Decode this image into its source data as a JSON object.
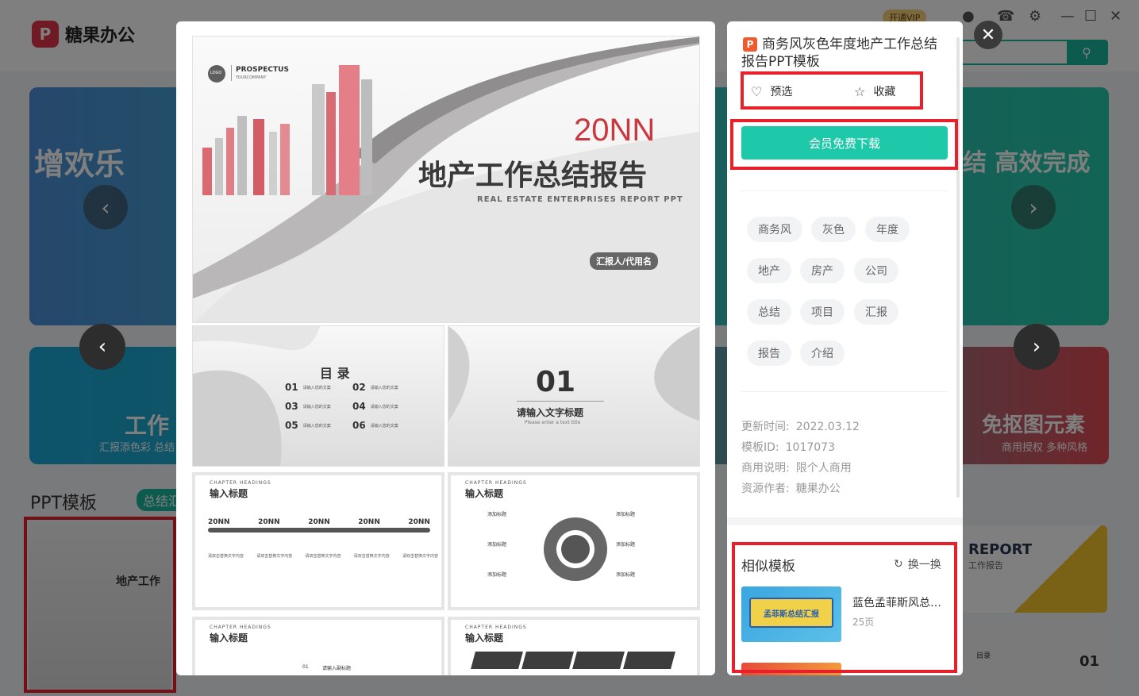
{
  "app": {
    "logo_text": "糖果办公",
    "vip_label": "开通VIP",
    "banner1_left": "增欢乐",
    "banner1_right": "结  高效完成",
    "banner2_left": "工作",
    "banner2_left_sub": "汇报添色彩 总结",
    "banner2_right": "免抠图元素",
    "banner2_right_sub": "商用授权 多种风格",
    "section_title": "PPT模板",
    "section_chip": "总结汇",
    "bg_thumb_title": "地产工作",
    "bg_thumb2_report": "REPORT",
    "bg_thumb2_sub": "工作报告",
    "bg_thumb3_num": "01",
    "bg_thumb3_title": "目录"
  },
  "preview": {
    "cover": {
      "logo": "LOGO",
      "prospectus": "PROSPECTUS",
      "company": "YOURCOMPANY",
      "year": "20NN",
      "title": "地产工作总结报告",
      "subtitle": "REAL ESTATE ENTERPRISES REPORT PPT",
      "reporter": "汇报人/代用名"
    },
    "toc": {
      "heading": "目  录",
      "items": [
        {
          "num": "01",
          "text": "请输入您的文案"
        },
        {
          "num": "02",
          "text": "请输入您的文案"
        },
        {
          "num": "03",
          "text": "请输入您的文案"
        },
        {
          "num": "04",
          "text": "请输入您的文案"
        },
        {
          "num": "05",
          "text": "请输入您的文案"
        },
        {
          "num": "06",
          "text": "请输入您的文案"
        }
      ]
    },
    "chapter": {
      "num": "01",
      "title": "请输入文字标题",
      "sub": "Please enter a text title"
    },
    "slide_heading": "CHAPTER HEADINGS",
    "slide_title": "输入标题",
    "timeline_years": [
      "20NN",
      "20NN",
      "20NN",
      "20NN",
      "20NN"
    ],
    "timeline_caption": "请双击替换文字内容",
    "radial_label": "添加标题",
    "sub_title_label": "请输入副标题",
    "sub_num": "01"
  },
  "info": {
    "title": "商务风灰色年度地产工作总结报告PPT模板",
    "ppt_icon": "P",
    "preselect": "预选",
    "favorite": "收藏",
    "download": "会员免费下载",
    "tags": [
      "商务风",
      "灰色",
      "年度",
      "地产",
      "房产",
      "公司",
      "总结",
      "项目",
      "汇报",
      "报告",
      "介绍"
    ],
    "meta": [
      {
        "label": "更新时间:",
        "value": "2022.03.12"
      },
      {
        "label": "模板ID:",
        "value": "1017073"
      },
      {
        "label": "商用说明:",
        "value": "限个人商用"
      },
      {
        "label": "资源作者:",
        "value": "糖果办公"
      }
    ],
    "similar_title": "相似模板",
    "refresh": "换一换",
    "similar_items": [
      {
        "name": "蓝色孟菲斯风总结汇报",
        "pages": "25页",
        "thumb_text": "孟菲斯总结汇报"
      }
    ]
  }
}
